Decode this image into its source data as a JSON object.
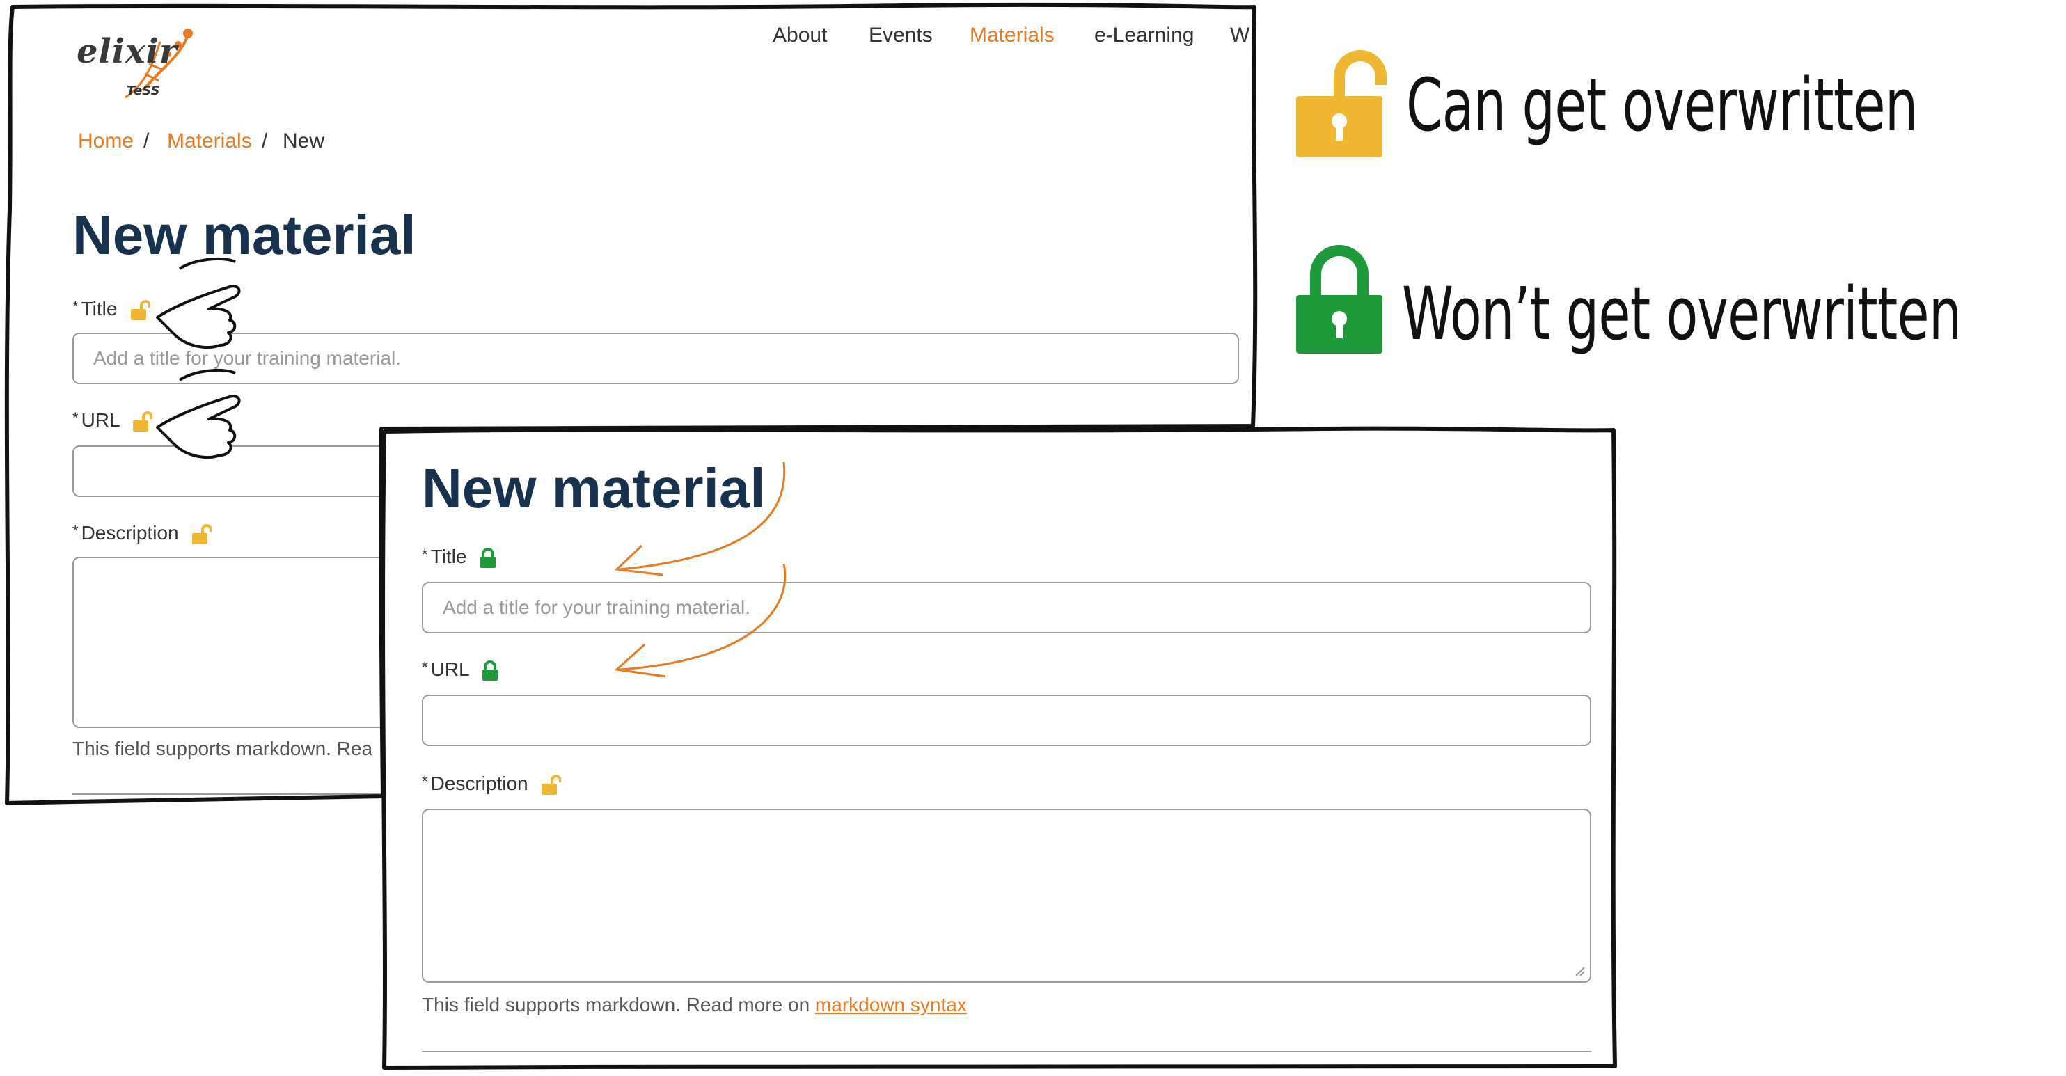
{
  "colors": {
    "accent": "#e87a22",
    "title": "#16324f",
    "lock_open": "#f0b832",
    "lock_closed": "#1f9a3a"
  },
  "back_page": {
    "logo": {
      "word": "elixir",
      "sub": "TeSS"
    },
    "nav": [
      "About",
      "Events",
      "Materials",
      "e-Learning",
      "W"
    ],
    "nav_active": "Materials",
    "breadcrumb": {
      "home": "Home",
      "sep": "/",
      "materials": "Materials",
      "current": "New"
    },
    "title": "New material",
    "fields": {
      "title_label": "Title",
      "title_placeholder": "Add a title for your training material.",
      "url_label": "URL",
      "description_label": "Description",
      "required_mark": "*"
    },
    "help_text": "This field supports markdown. Rea",
    "title_lock": "lock-open-icon",
    "url_lock": "lock-open-icon",
    "description_lock": "lock-open-icon"
  },
  "front_page": {
    "title": "New material",
    "fields": {
      "title_label": "Title",
      "title_placeholder": "Add a title for your training material.",
      "url_label": "URL",
      "description_label": "Description",
      "required_mark": "*"
    },
    "title_lock": "lock-closed-icon",
    "url_lock": "lock-closed-icon",
    "description_lock": "lock-open-icon",
    "help_prefix": "This field supports markdown. Read more on ",
    "help_link": "markdown syntax"
  },
  "legend": {
    "open": {
      "icon": "lock-open-icon",
      "text": "Can get overwritten"
    },
    "closed": {
      "icon": "lock-closed-icon",
      "text": "Won’t get overwritten"
    }
  }
}
